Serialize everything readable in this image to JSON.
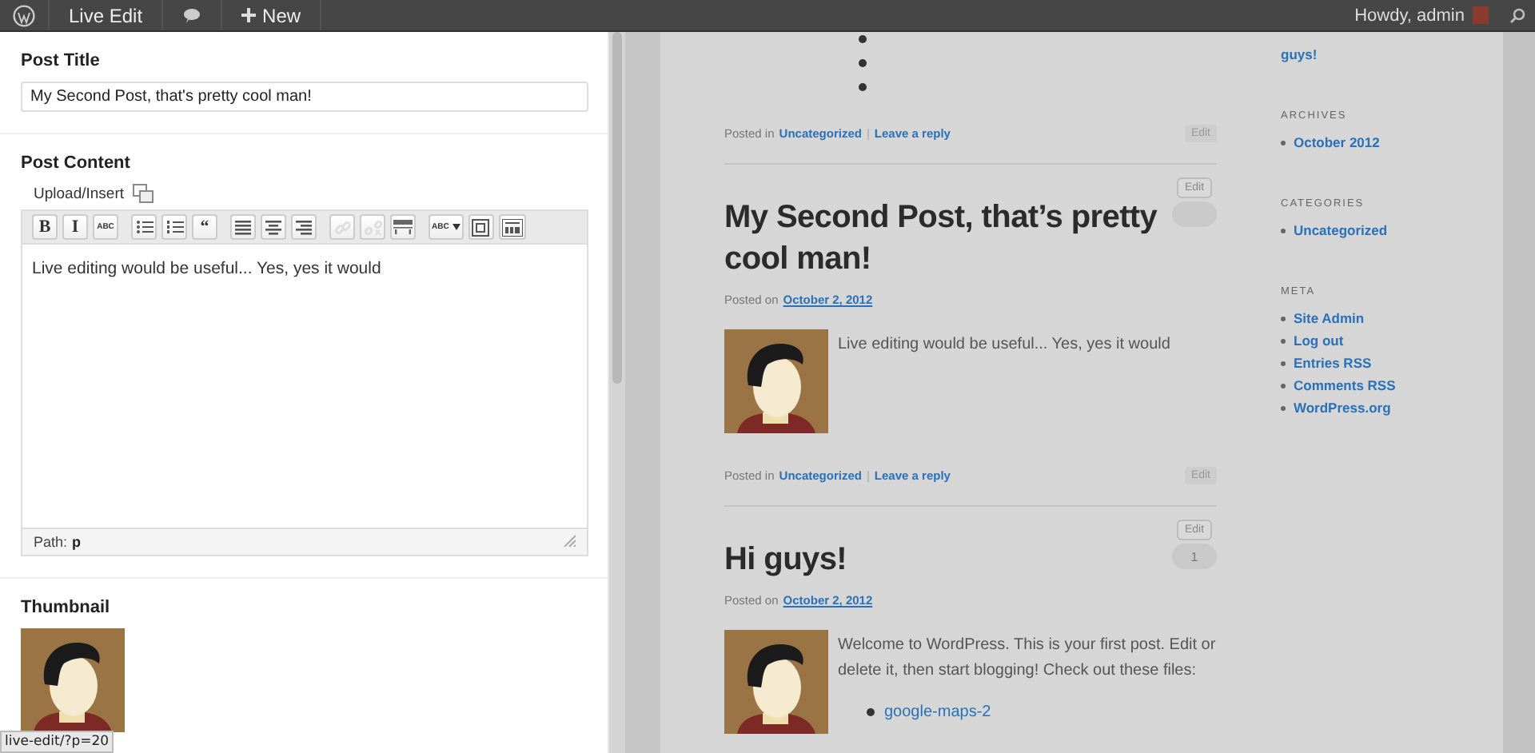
{
  "admin_bar": {
    "items": [
      {
        "kind": "logo"
      },
      {
        "kind": "text",
        "label": "Live Edit"
      },
      {
        "kind": "comments"
      },
      {
        "kind": "new",
        "label": "New"
      }
    ],
    "greeting": "Howdy, admin"
  },
  "editor": {
    "title_label": "Post Title",
    "title_value": "My Second Post, that's pretty cool man!",
    "content_label": "Post Content",
    "upload_label": "Upload/Insert",
    "toolbar": [
      {
        "kind": "text",
        "label": "B",
        "disabled": false
      },
      {
        "kind": "text",
        "label": "I",
        "disabled": false
      },
      {
        "kind": "small",
        "label": "ABC",
        "disabled": false
      },
      {
        "kind": "bullets",
        "disabled": false
      },
      {
        "kind": "numbers",
        "disabled": false
      },
      {
        "kind": "text",
        "label": "“",
        "disabled": false
      },
      {
        "kind": "align-left",
        "disabled": false
      },
      {
        "kind": "align-center",
        "disabled": false
      },
      {
        "kind": "align-right",
        "disabled": false
      },
      {
        "kind": "link",
        "disabled": true
      },
      {
        "kind": "unlink",
        "disabled": true
      },
      {
        "kind": "more",
        "disabled": false
      },
      {
        "kind": "spell",
        "label": "ABC",
        "disabled": false
      },
      {
        "kind": "fullscreen",
        "disabled": false
      },
      {
        "kind": "sink",
        "disabled": false
      }
    ],
    "content": "Live editing would be useful... Yes, yes it would",
    "path_label": "Path:",
    "path_value": "p",
    "thumbnail_label": "Thumbnail",
    "status_url": "live-edit/?p=20"
  },
  "preview": {
    "posts": [
      {
        "kind": "fragment",
        "footer": {
          "posted_in": "Posted in",
          "category": "Uncategorized",
          "separator": "|",
          "reply": "Leave a reply",
          "edit": "Edit"
        }
      },
      {
        "kind": "post",
        "title": "My Second Post, that’s pretty cool man!",
        "edit": "Edit",
        "posted_on": "Posted on",
        "date": "October 2, 2012",
        "text": "Live editing would be useful... Yes, yes it would",
        "footer": {
          "posted_in": "Posted in",
          "category": "Uncategorized",
          "separator": "|",
          "reply": "Leave a reply",
          "edit": "Edit"
        }
      },
      {
        "kind": "post",
        "title": "Hi guys!",
        "edit": "Edit",
        "comments": "1",
        "posted_on": "Posted on",
        "date": "October 2, 2012",
        "text": "Welcome to WordPress. This is your first post. Edit or delete it, then start blogging! Check out these files:",
        "links": [
          "google-maps-2"
        ]
      }
    ],
    "sidebar_top": "guys!",
    "widgets": [
      {
        "title": "ARCHIVES",
        "items": [
          "October 2012"
        ]
      },
      {
        "title": "CATEGORIES",
        "items": [
          "Uncategorized"
        ]
      },
      {
        "title": "META",
        "items": [
          "Site Admin",
          "Log out",
          "Entries RSS",
          "Comments RSS",
          "WordPress.org"
        ]
      }
    ]
  }
}
